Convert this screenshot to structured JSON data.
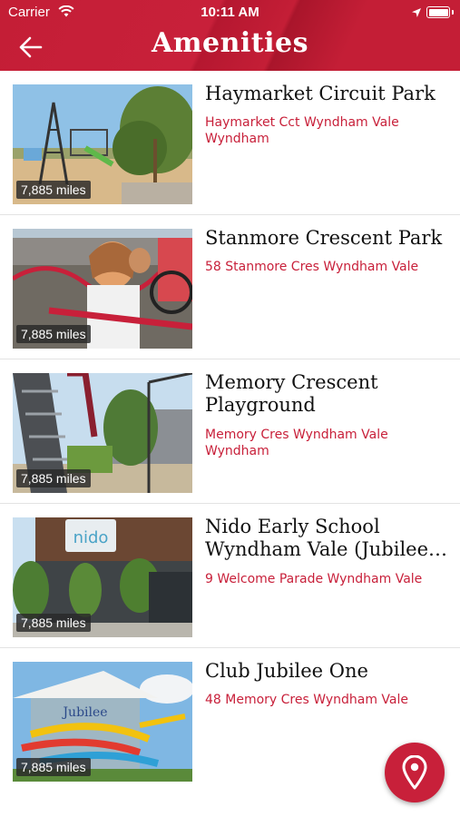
{
  "status_bar": {
    "carrier": "Carrier",
    "time": "10:11 AM"
  },
  "header": {
    "title": "Amenities"
  },
  "colors": {
    "brand_red": "#c8203a"
  },
  "icons": {
    "back": "arrow-left-icon",
    "map": "map-pin-icon"
  },
  "items": [
    {
      "name": "Haymarket Circuit Park",
      "address": "Haymarket Cct Wyndham Vale Wyndham",
      "distance": "7,885 miles"
    },
    {
      "name": "Stanmore Crescent Park",
      "address": "58 Stanmore Cres Wyndham Vale",
      "distance": "7,885 miles"
    },
    {
      "name": "Memory Crescent Playground",
      "address": "Memory Cres Wyndham Vale Wyndham",
      "distance": "7,885 miles"
    },
    {
      "name": "Nido Early School Wyndham Vale (Jubilee Estate)",
      "address": "9 Welcome Parade Wyndham Vale",
      "distance": "7,885 miles"
    },
    {
      "name": "Club Jubilee One",
      "address": "48 Memory Cres Wyndham Vale",
      "distance": "7,885 miles"
    }
  ]
}
